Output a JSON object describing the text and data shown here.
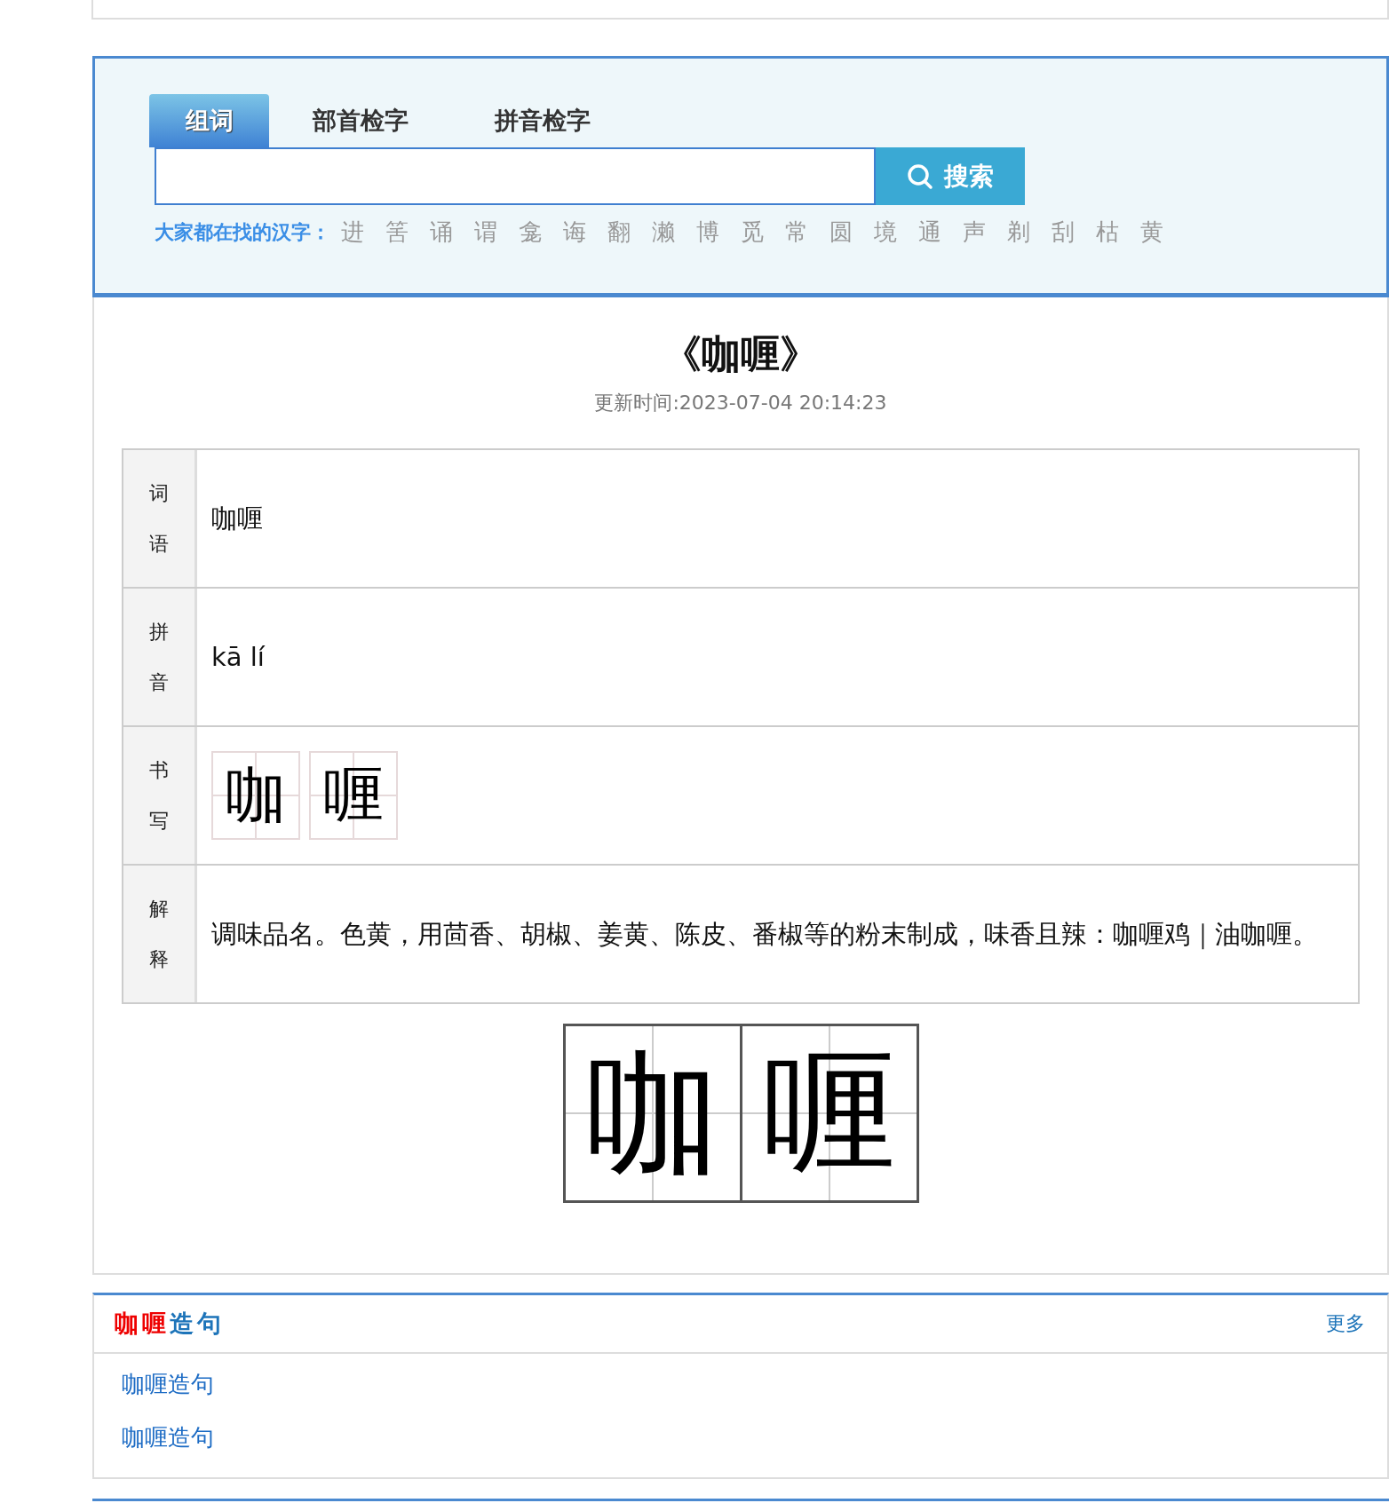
{
  "search": {
    "tabs": [
      {
        "label": "组词",
        "selected": true
      },
      {
        "label": "部首检字",
        "selected": false
      },
      {
        "label": "拼音检字",
        "selected": false
      }
    ],
    "button": "搜索",
    "hot_label": "大家都在找的汉字：",
    "hot_chars": [
      "进",
      "筈",
      "诵",
      "谓",
      "龛",
      "诲",
      "翻",
      "濑",
      "博",
      "觅",
      "常",
      "圆",
      "境",
      "通",
      "声",
      "剃",
      "刮",
      "枯",
      "黄"
    ]
  },
  "word": {
    "title": "《咖喱》",
    "updated": "更新时间:2023-07-04 20:14:23",
    "rows": [
      {
        "kind": "text",
        "label": "词语",
        "value": "咖喱"
      },
      {
        "kind": "text",
        "label": "拼音",
        "value": "kā lí"
      },
      {
        "kind": "chars",
        "label": "书写",
        "chars": [
          "咖",
          "喱"
        ]
      },
      {
        "kind": "text",
        "label": "解释",
        "value": "调味品名。色黄，用茴香、胡椒、姜黄、陈皮、番椒等的粉末制成，味香且辣：咖喱鸡｜油咖喱。"
      }
    ],
    "calligraphy": [
      "咖",
      "喱"
    ]
  },
  "sentences": {
    "title_word": "咖喱",
    "title_suffix": "造句",
    "more": "更多",
    "items": [
      "咖喱造句",
      "咖喱造句"
    ]
  }
}
